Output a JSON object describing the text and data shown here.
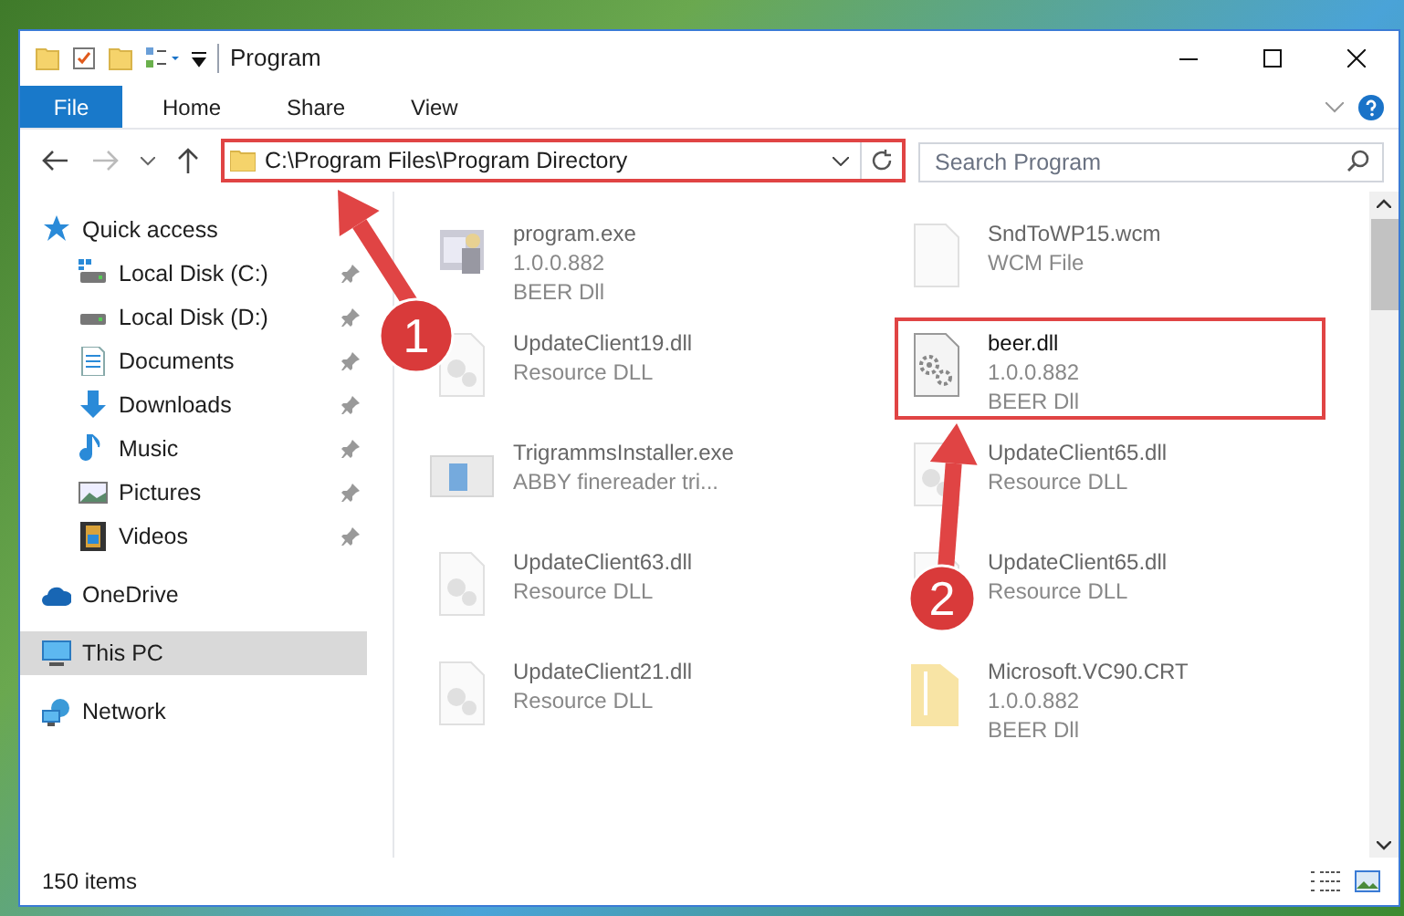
{
  "window": {
    "title": "Program"
  },
  "ribbon_tabs": [
    {
      "label": "File",
      "kind": "file"
    },
    {
      "label": "Home",
      "kind": "tab"
    },
    {
      "label": "Share",
      "kind": "tab"
    },
    {
      "label": "View",
      "kind": "tab"
    }
  ],
  "address_bar": {
    "value": "C:\\Program Files\\Program Directory",
    "highlighted": true
  },
  "search": {
    "placeholder": "Search Program"
  },
  "sidebar": [
    {
      "label": "Quick access",
      "selected": false,
      "children": [
        {
          "label": "Local Disk (C:)",
          "pinned": true,
          "selected": false
        },
        {
          "label": "Local Disk (D:)",
          "pinned": true,
          "selected": false
        },
        {
          "label": "Documents",
          "pinned": true,
          "selected": false
        },
        {
          "label": "Downloads",
          "pinned": true,
          "selected": false
        },
        {
          "label": "Music",
          "pinned": true,
          "selected": false
        },
        {
          "label": "Pictures",
          "pinned": true,
          "selected": false
        },
        {
          "label": "Videos",
          "pinned": true,
          "selected": false
        }
      ]
    },
    {
      "label": "OneDrive",
      "selected": false
    },
    {
      "label": "This PC",
      "selected": true
    },
    {
      "label": "Network",
      "selected": false
    }
  ],
  "files": [
    {
      "name": "program.exe",
      "details": [
        "1.0.0.882",
        "BEER Dll"
      ],
      "kind": "exe",
      "highlighted": false
    },
    {
      "name": "SndToWP15.wcm",
      "details": [
        "WCM File"
      ],
      "kind": "blank",
      "highlighted": false
    },
    {
      "name": "UpdateClient19.dll",
      "details": [
        "Resource DLL"
      ],
      "kind": "dll",
      "highlighted": false
    },
    {
      "name": "beer.dll",
      "details": [
        "1.0.0.882",
        "BEER Dll"
      ],
      "kind": "gears",
      "highlighted": true
    },
    {
      "name": "TrigrammsInstaller.exe",
      "details": [
        "ABBY finereader tri..."
      ],
      "kind": "installer",
      "highlighted": false
    },
    {
      "name": "UpdateClient65.dll",
      "details": [
        "Resource DLL"
      ],
      "kind": "dll",
      "highlighted": false
    },
    {
      "name": "UpdateClient63.dll",
      "details": [
        "Resource DLL"
      ],
      "kind": "dll",
      "highlighted": false
    },
    {
      "name": "UpdateClient65.dll",
      "details": [
        "Resource DLL"
      ],
      "kind": "dll",
      "highlighted": false
    },
    {
      "name": "UpdateClient21.dll",
      "details": [
        "Resource DLL"
      ],
      "kind": "dll",
      "highlighted": false
    },
    {
      "name": "Microsoft.VC90.CRT",
      "details": [
        "1.0.0.882",
        "BEER Dll"
      ],
      "kind": "folder",
      "highlighted": false
    }
  ],
  "annotations": [
    {
      "label": "1"
    },
    {
      "label": "2"
    }
  ],
  "status_bar": {
    "item_count": "150 items"
  }
}
